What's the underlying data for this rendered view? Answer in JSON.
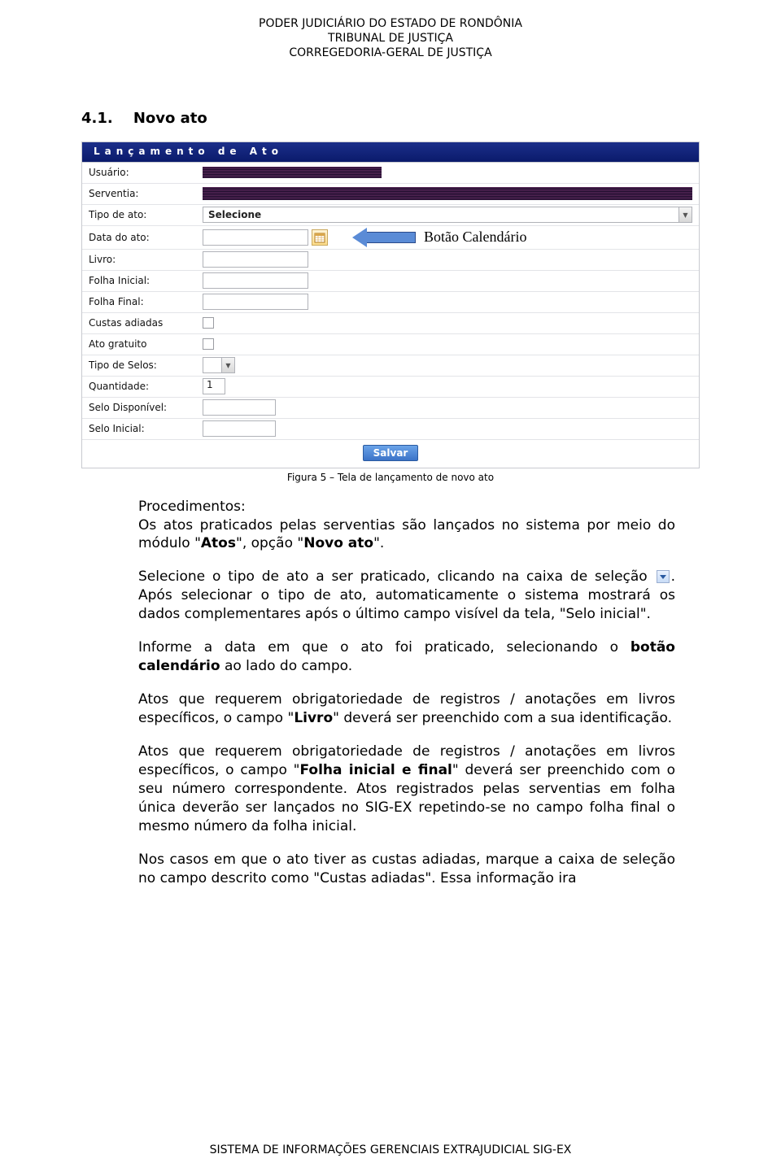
{
  "header": {
    "line1": "PODER JUDICIÁRIO DO ESTADO DE RONDÔNIA",
    "line2": "TRIBUNAL DE JUSTIÇA",
    "line3": "CORREGEDORIA-GERAL DE JUSTIÇA"
  },
  "section": {
    "number": "4.1.",
    "title": "Novo ato"
  },
  "form": {
    "panel_title": "Lançamento de Ato",
    "labels": {
      "usuario": "Usuário:",
      "serventia": "Serventia:",
      "tipo_ato": "Tipo de ato:",
      "data_ato": "Data do ato:",
      "livro": "Livro:",
      "folha_inicial": "Folha Inicial:",
      "folha_final": "Folha Final:",
      "custas_adiadas": "Custas adiadas",
      "ato_gratuito": "Ato gratuito",
      "tipo_selos": "Tipo de Selos:",
      "quantidade": "Quantidade:",
      "selo_disponivel": "Selo Disponível:",
      "selo_inicial": "Selo Inicial:"
    },
    "values": {
      "tipo_ato_selected": "Selecione",
      "quantidade": "1"
    },
    "callout": "Botão Calendário",
    "save_button": "Salvar"
  },
  "caption": "Figura 5 – Tela de lançamento de novo ato",
  "body": {
    "p1_label": "Procedimentos:",
    "p1_rest": "Os atos praticados pelas serventias são lançados no sistema por meio do módulo ",
    "p1_bold1": "Atos",
    "p1_mid": ", opção ",
    "p1_bold2": "Novo ato",
    "p1_end": ".",
    "p2_a": "Selecione o tipo de ato a ser praticado, clicando na caixa de seleção ",
    "p2_b": ". Após selecionar o tipo de ato, automaticamente o sistema mostrará os dados complementares após o último campo visível da tela, \"Selo inicial\".",
    "p3_a": "Informe a data em que o ato foi praticado, selecionando o ",
    "p3_bold": "botão calendário",
    "p3_b": " ao lado do campo.",
    "p4_a": "Atos que requerem obrigatoriedade de registros / anotações em livros específicos, o campo \"",
    "p4_bold": "Livro",
    "p4_b": "\" deverá ser preenchido com a sua identificação.",
    "p5_a": "Atos que requerem obrigatoriedade de registros / anotações em livros específicos, o campo \"",
    "p5_bold": "Folha inicial e final",
    "p5_b": "\" deverá  ser preenchido com o seu número correspondente. Atos registrados pelas serventias em folha única deverão ser lançados no SIG-EX repetindo-se no campo folha final o mesmo número da folha inicial.",
    "p6": "Nos casos em que o ato tiver as custas adiadas, marque a caixa de seleção no campo descrito como \"Custas adiadas\". Essa informação ira"
  },
  "footer": "SISTEMA DE INFORMAÇÕES GERENCIAIS EXTRAJUDICIAL SIG-EX"
}
